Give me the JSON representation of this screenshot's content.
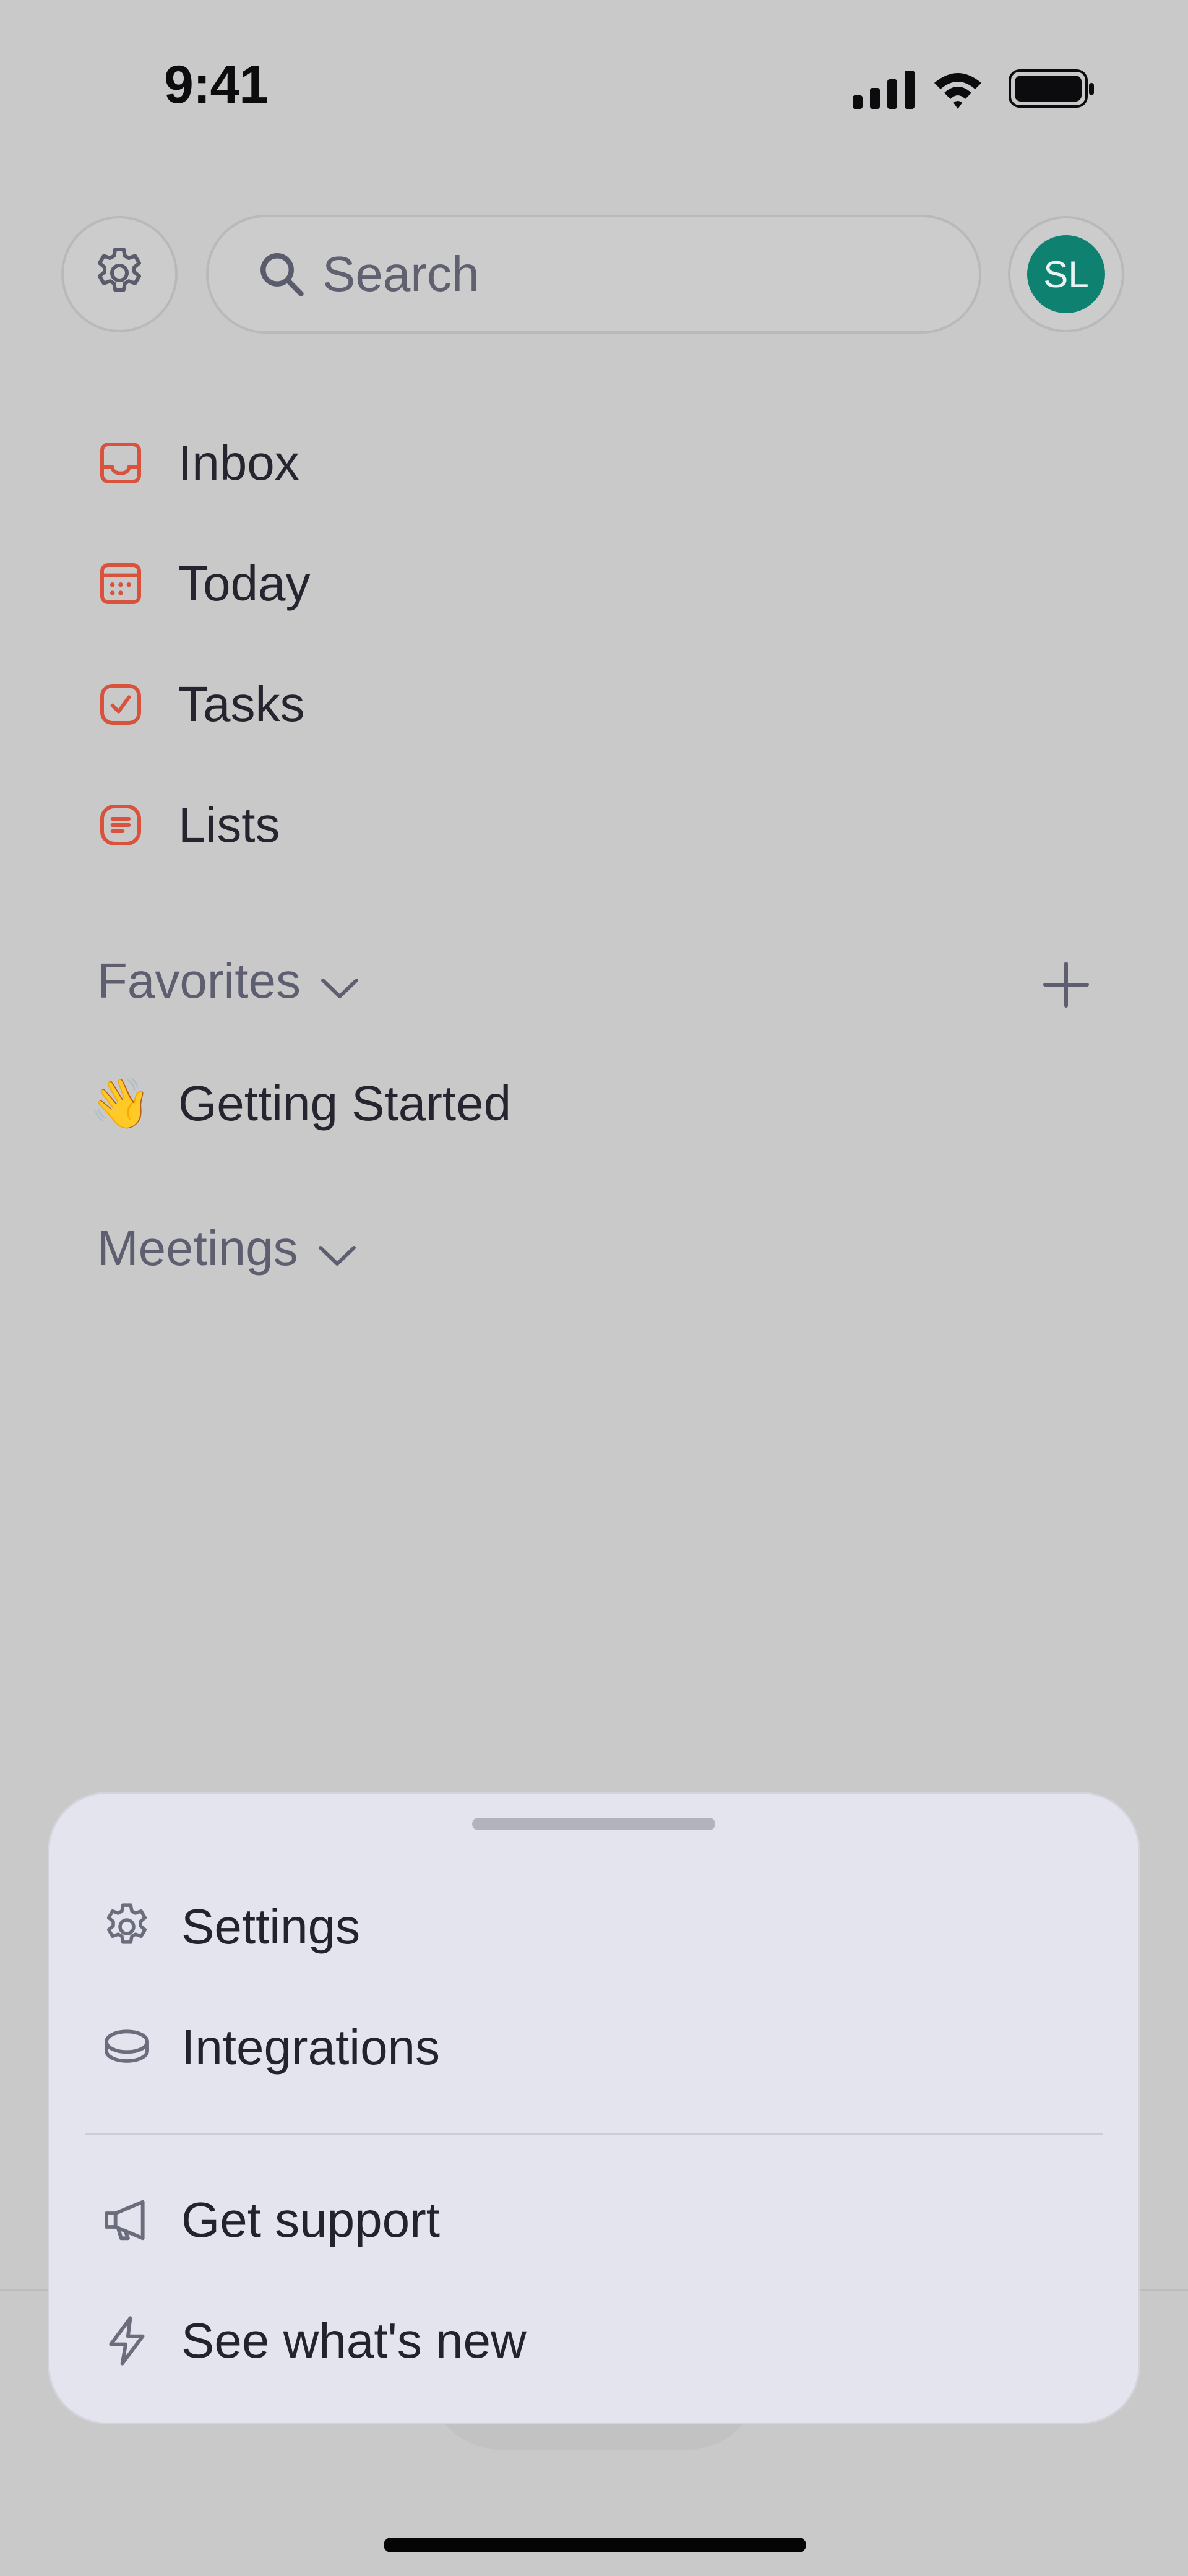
{
  "status_bar": {
    "time": "9:41"
  },
  "top_bar": {
    "search_placeholder": "Search",
    "avatar_initials": "SL",
    "avatar_color": "#0f8171"
  },
  "nav": {
    "accent_color": "#d9533c",
    "items": [
      {
        "label": "Inbox",
        "icon": "inbox-icon"
      },
      {
        "label": "Today",
        "icon": "calendar-icon"
      },
      {
        "label": "Tasks",
        "icon": "checkbox-icon"
      },
      {
        "label": "Lists",
        "icon": "list-icon"
      }
    ]
  },
  "favorites": {
    "title": "Favorites",
    "items": [
      {
        "emoji": "👋",
        "label": "Getting Started"
      }
    ]
  },
  "meetings": {
    "title": "Meetings"
  },
  "sheet": {
    "items": [
      {
        "label": "Settings",
        "icon": "gear-icon"
      },
      {
        "label": "Integrations",
        "icon": "layers-icon"
      }
    ],
    "items_secondary": [
      {
        "label": "Get support",
        "icon": "megaphone-icon"
      },
      {
        "label": "See what's new",
        "icon": "lightning-icon"
      }
    ]
  }
}
